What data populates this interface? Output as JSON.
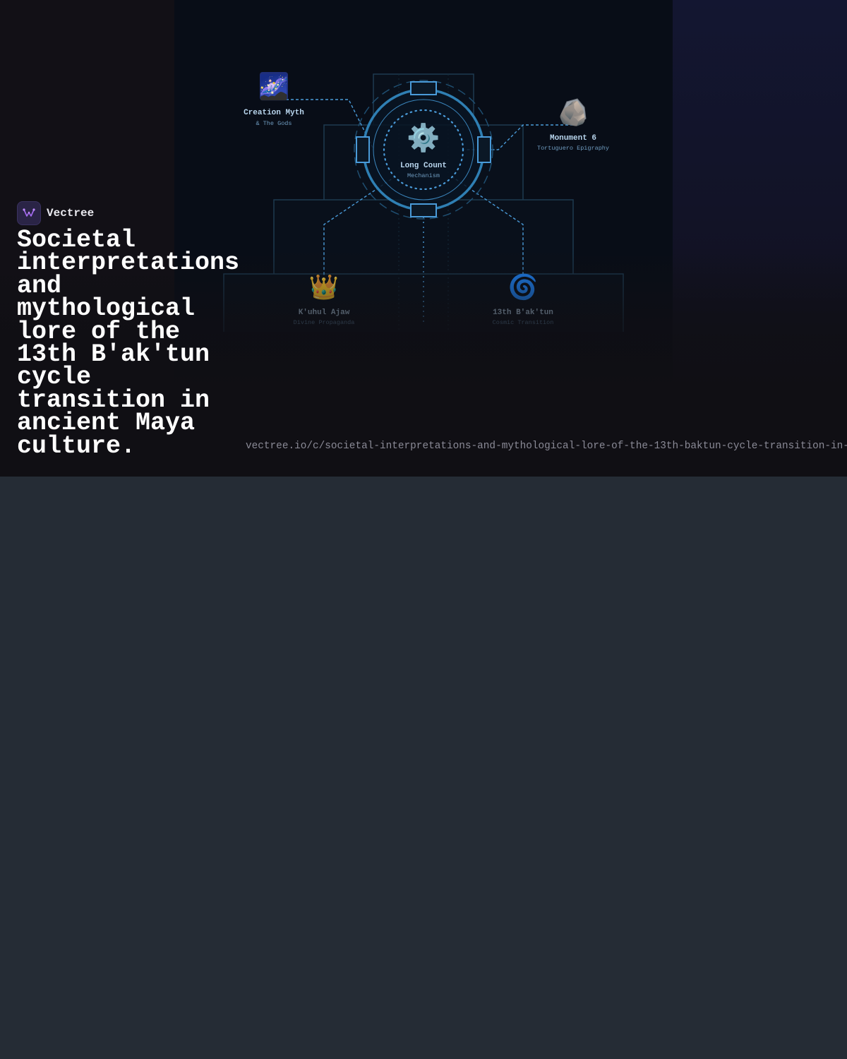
{
  "brand": {
    "name": "Vectree",
    "logo_icon": "vectree-logo-icon",
    "accent": "#a66bf2"
  },
  "headline": "Societal interpretations and mythological lore of the 13th B'ak'tun cycle transition in ancient Maya culture.",
  "url": "vectree.io/c/societal-interpretations-and-mythological-lore-of-the-13th-baktun-cycle-transition-in-ancient-maya-culture",
  "diagram": {
    "center": {
      "title": "Long Count",
      "subtitle": "Mechanism",
      "icon": "gear-icon",
      "emoji": "⚙️"
    },
    "nodes": [
      {
        "id": "creation",
        "title": "Creation Myth",
        "subtitle": "& The Gods",
        "icon": "milky-way-icon",
        "emoji": "🌌"
      },
      {
        "id": "monument",
        "title": "Monument 6",
        "subtitle": "Tortuguero Epigraphy",
        "icon": "rock-icon",
        "emoji": "🪨"
      },
      {
        "id": "kuhul",
        "title": "K'uhul Ajaw",
        "subtitle": "Divine Propaganda",
        "icon": "crown-icon",
        "emoji": "👑"
      },
      {
        "id": "baktun",
        "title": "13th B'ak'tun",
        "subtitle": "Cosmic Transition",
        "icon": "spiral-icon",
        "emoji": "🌀"
      }
    ],
    "colors": {
      "line": "#4a9bd9",
      "ring": "#2f7fb3",
      "pyramid": "#1d3a50",
      "title": "#b9d6ee",
      "subtitle": "#6f9cc0"
    }
  }
}
